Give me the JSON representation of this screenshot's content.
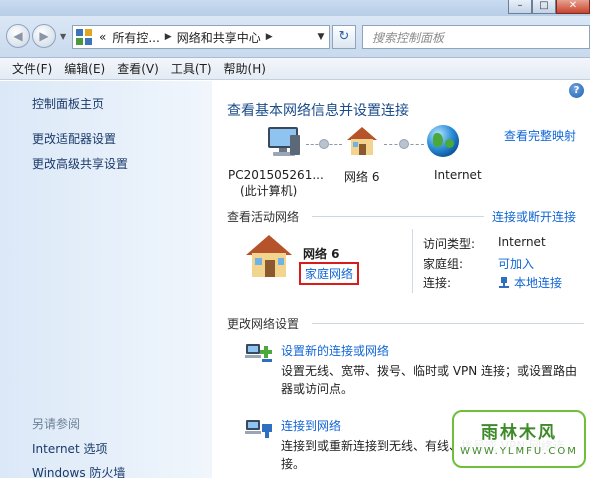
{
  "window": {
    "minimize": "–",
    "maximize": "□",
    "close": "✕"
  },
  "navigation": {
    "back_glyph": "◀",
    "forward_glyph": "▶",
    "breadcrumb": [
      "所有控...",
      "网络和共享中心"
    ],
    "breadcrumb_prefix": "«",
    "search_placeholder": "搜索控制面板"
  },
  "menu": [
    "文件(F)",
    "编辑(E)",
    "查看(V)",
    "工具(T)",
    "帮助(H)"
  ],
  "sidebar": {
    "home": "控制面板主页",
    "items": [
      "更改适配器设置",
      "更改高级共享设置"
    ],
    "see_also_heading": "另请参阅",
    "see_also": [
      "Internet 选项",
      "Windows 防火墙"
    ]
  },
  "main": {
    "help_glyph": "?",
    "title": "查看基本网络信息并设置连接",
    "view_full_map": "查看完整映射",
    "map": {
      "computer_name": "PC201505261...",
      "computer_sub": "(此计算机)",
      "network_name": "网络  6",
      "internet": "Internet"
    },
    "active_heading": "查看活动网络",
    "connect_disconnect": "连接或断开连接",
    "active_network": {
      "name": "网络  6",
      "type": "家庭网络",
      "access_type_label": "访问类型:",
      "access_type_value": "Internet",
      "homegroup_label": "家庭组:",
      "homegroup_value": "可加入",
      "connection_label": "连接:",
      "connection_value": "本地连接"
    },
    "change_heading": "更改网络设置",
    "tasks": [
      {
        "title": "设置新的连接或网络",
        "desc": "设置无线、宽带、拨号、临时或 VPN 连接；或设置路由器或访问点。"
      },
      {
        "title": "连接到网络",
        "desc": "连接到或重新连接到无线、有线、拨号或 VPN 网络连接。"
      }
    ]
  },
  "watermark": {
    "main": "雨林木风",
    "sub": "WWW.YLMFU.COM"
  },
  "colors": {
    "link": "#1066d6",
    "title": "#1b4b8a",
    "highlight_box": "#d81c1c"
  }
}
